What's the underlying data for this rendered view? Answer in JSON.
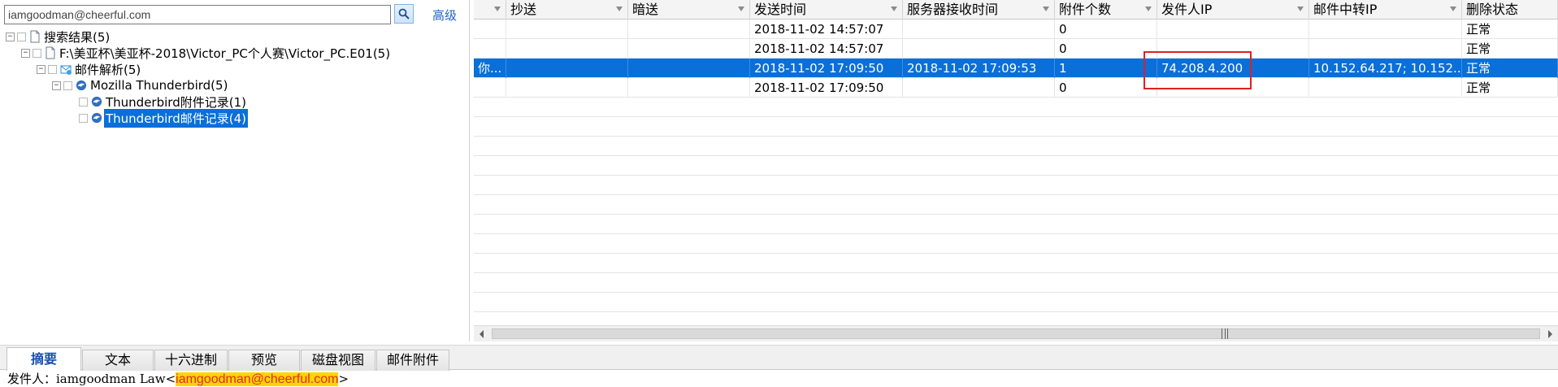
{
  "search": {
    "value": "iamgoodman@cheerful.com",
    "advanced_label": "高级"
  },
  "tree": {
    "root": "搜索结果(5)",
    "path": "F:\\美亚杯\\美亚杯-2018\\Victor_PC个人赛\\Victor_PC.E01(5)",
    "mail_parse": "邮件解析(5)",
    "client": "Mozilla Thunderbird(5)",
    "attachments": "Thunderbird附件记录(1)",
    "emails": "Thunderbird邮件记录(4)"
  },
  "grid": {
    "columns": [
      "抄送",
      "暗送",
      "发送时间",
      "服务器接收时间",
      "附件个数",
      "发件人IP",
      "邮件中转IP",
      "删除状态"
    ],
    "rows": [
      {
        "c0": "",
        "cc": "",
        "bcc": "",
        "send_time": "2018-11-02 14:57:07",
        "recv_time": "",
        "attach_count": "0",
        "sender_ip": "",
        "relay_ip": "",
        "status": "正常"
      },
      {
        "c0": "",
        "cc": "",
        "bcc": "",
        "send_time": "2018-11-02 14:57:07",
        "recv_time": "",
        "attach_count": "0",
        "sender_ip": "",
        "relay_ip": "",
        "status": "正常"
      },
      {
        "c0": "你...",
        "cc": "",
        "bcc": "",
        "send_time": "2018-11-02 17:09:50",
        "recv_time": "2018-11-02 17:09:53",
        "attach_count": "1",
        "sender_ip": "74.208.4.200",
        "relay_ip": "10.152.64.217; 10.152...",
        "status": "正常"
      },
      {
        "c0": "",
        "cc": "",
        "bcc": "",
        "send_time": "2018-11-02 17:09:50",
        "recv_time": "",
        "attach_count": "0",
        "sender_ip": "",
        "relay_ip": "",
        "status": "正常"
      }
    ]
  },
  "tabs": [
    "摘要",
    "文本",
    "十六进制",
    "预览",
    "磁盘视图",
    "邮件附件"
  ],
  "detail": {
    "prefix": "发件人：iamgoodman Law<",
    "email": "iamgoodman@cheerful.com",
    "suffix": ">"
  },
  "colors": {
    "selection": "#0a6fd8",
    "highlight_box": "#e02020",
    "email_highlight": "#ffd400",
    "link": "#1e64c8"
  }
}
